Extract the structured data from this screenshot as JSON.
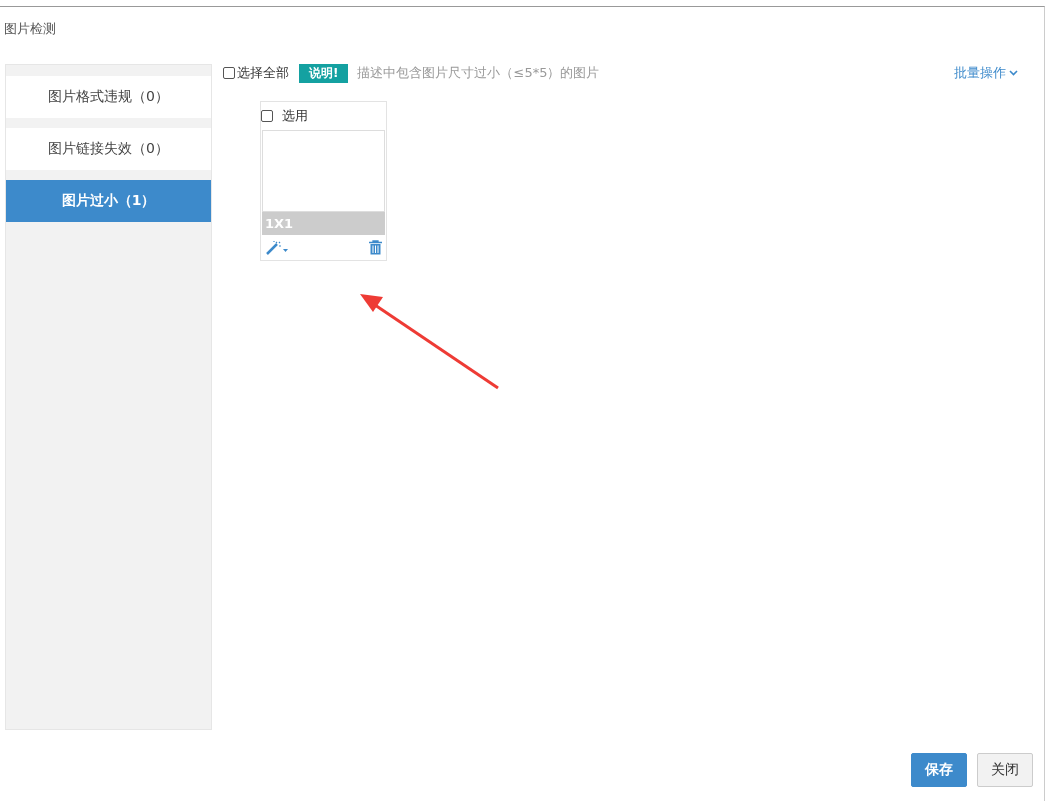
{
  "dialog": {
    "title": "图片检测"
  },
  "sidebar": {
    "items": [
      {
        "label": "图片格式违规（0）",
        "selected": false
      },
      {
        "label": "图片链接失效（0）",
        "selected": false
      },
      {
        "label": "图片过小（1）",
        "selected": true
      }
    ]
  },
  "toolbar": {
    "select_all": {
      "label": "选择全部",
      "checked": false
    },
    "badge": "说明!",
    "description": "描述中包含图片尺寸过小（≤5*5）的图片",
    "batch_menu": "批量操作"
  },
  "images": [
    {
      "label": "选用",
      "checked": false,
      "size": "1X1"
    }
  ],
  "buttons": [
    {
      "label": "保存",
      "kind": "primary"
    },
    {
      "label": "关闭",
      "kind": "default"
    }
  ]
}
